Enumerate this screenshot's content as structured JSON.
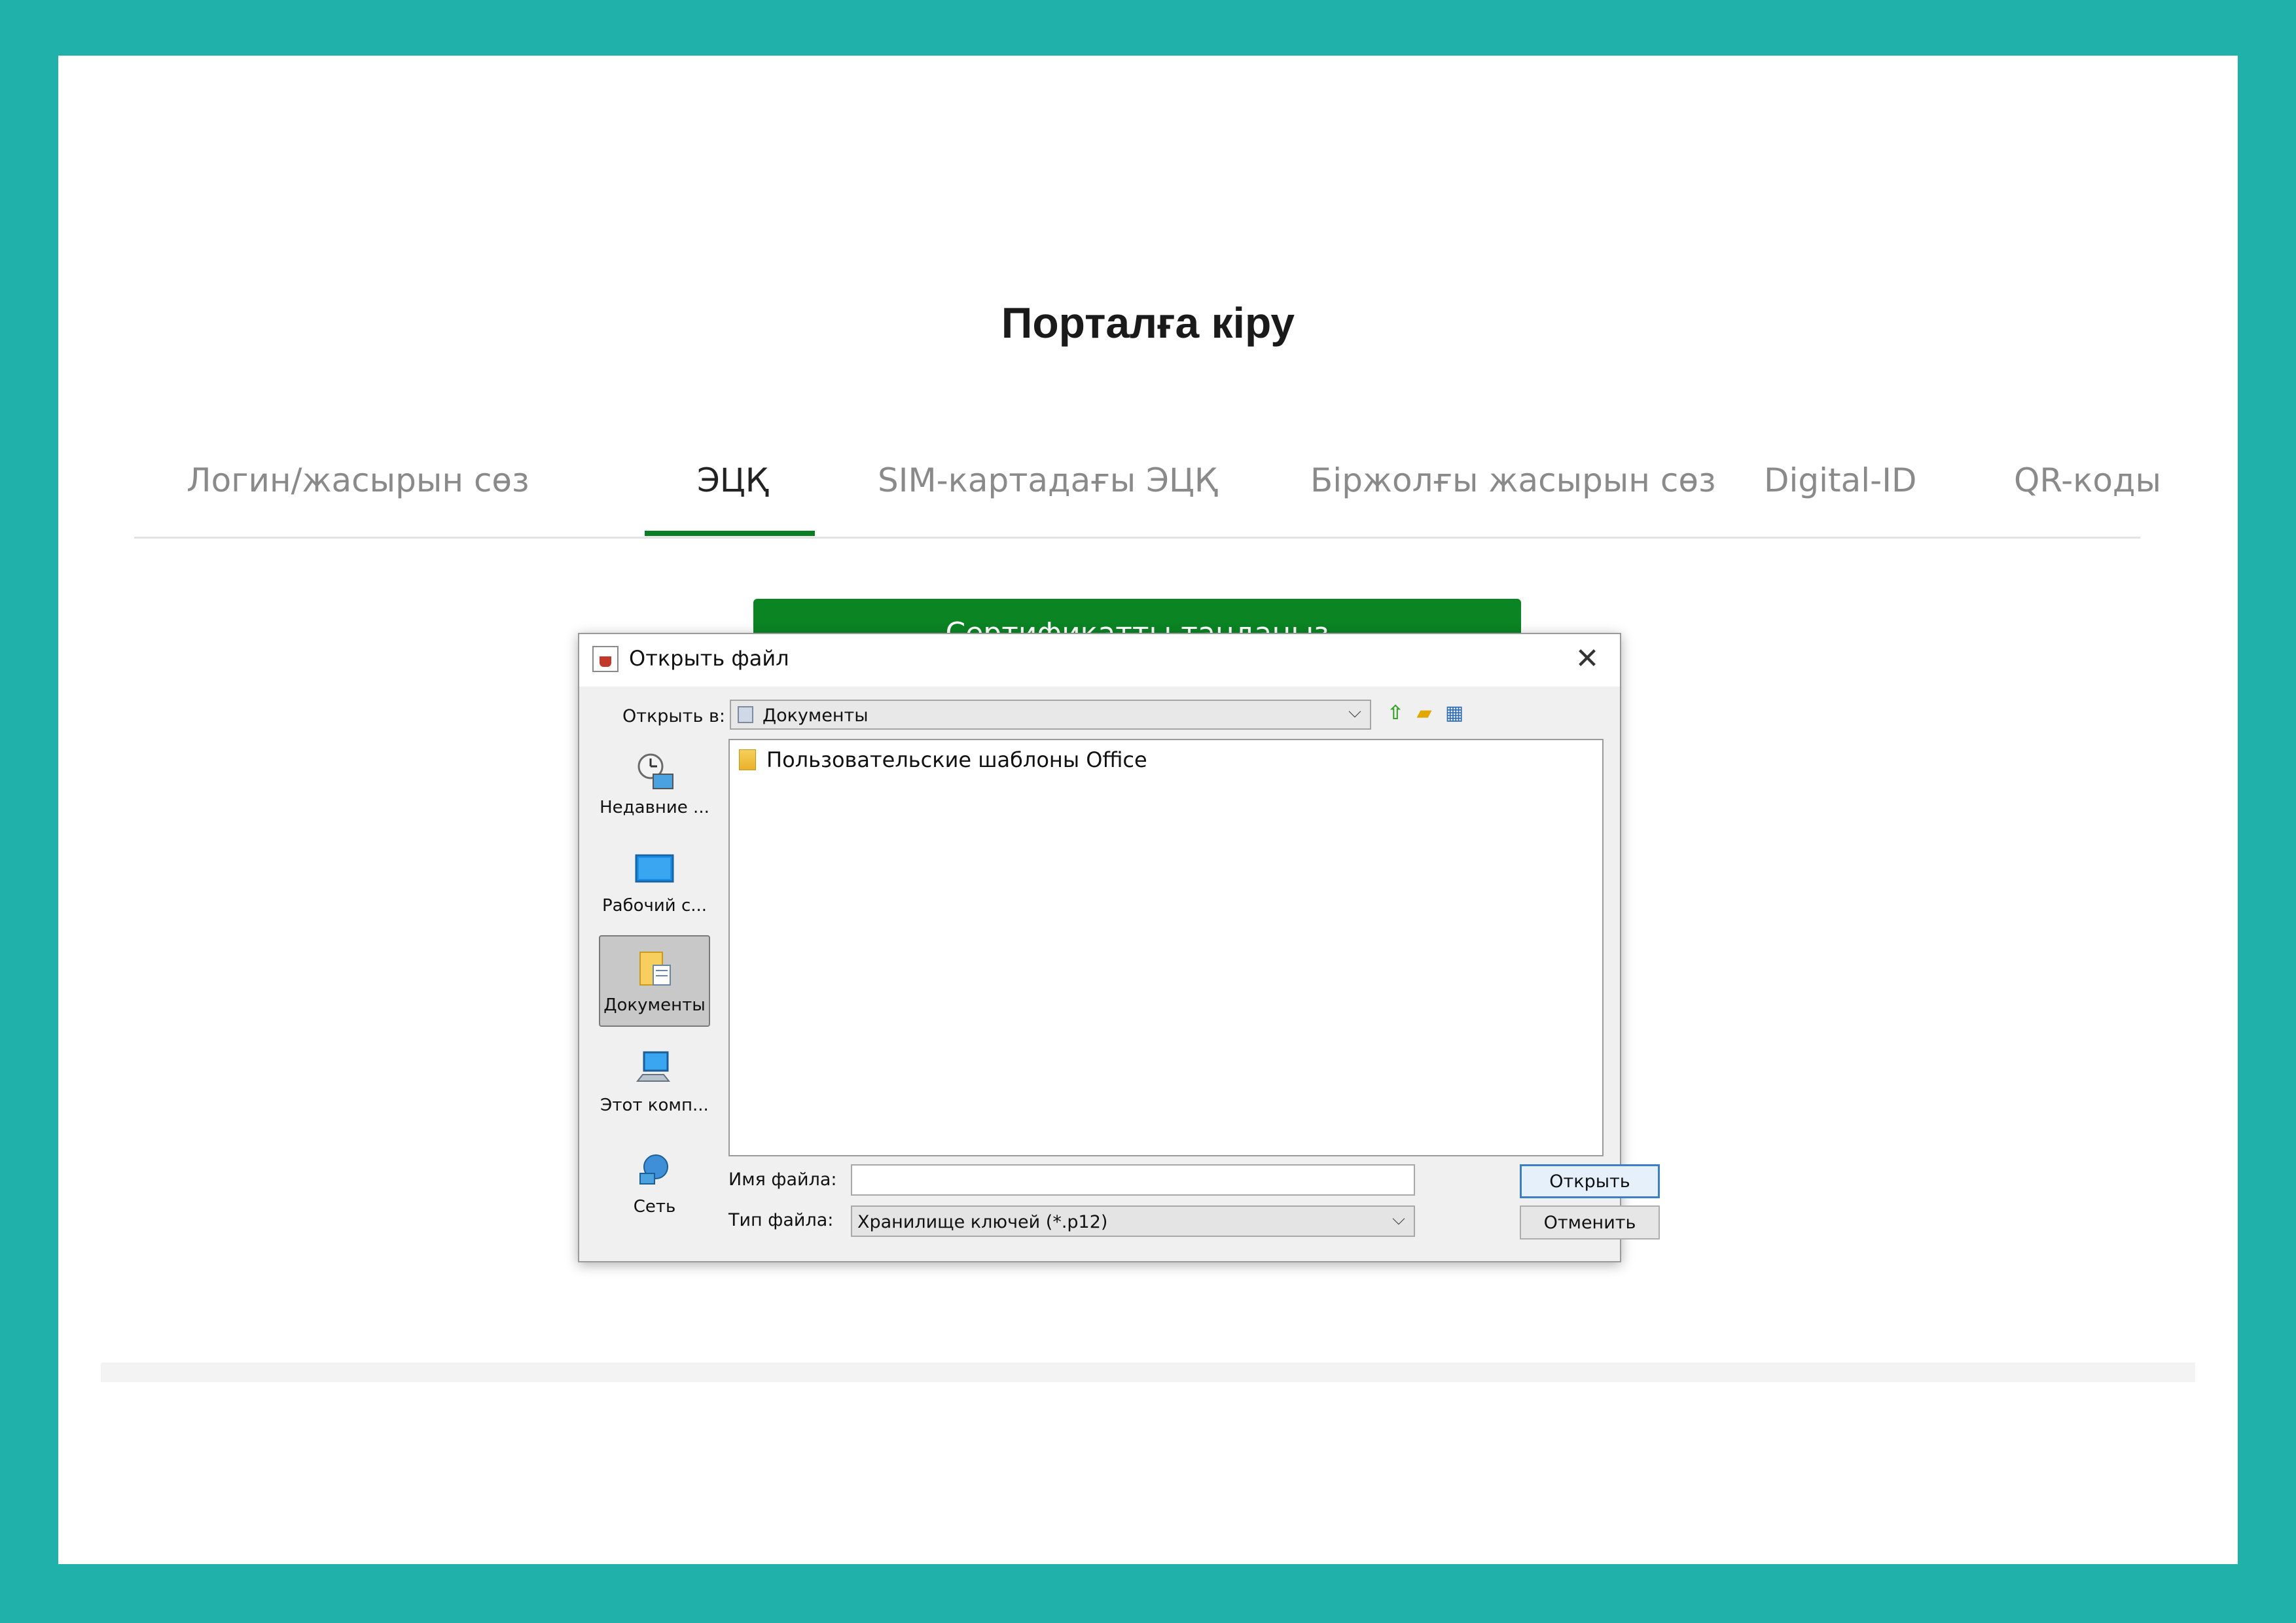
{
  "page": {
    "title": "Порталға кіру",
    "tabs": [
      {
        "label": "Логин/жасырын сөз",
        "active": false
      },
      {
        "label": "ЭЦҚ",
        "active": true
      },
      {
        "label": "SIM-картадағы ЭЦҚ",
        "active": false
      },
      {
        "label": "Біржолғы жасырын сөз",
        "active": false
      },
      {
        "label": "Digital-ID",
        "active": false
      },
      {
        "label": "QR-коды",
        "active": false
      }
    ],
    "select_cert_button": "Сертификатты таңдаңыз",
    "accent_color": "#0b8424",
    "frame_color": "#20b2aa"
  },
  "dialog": {
    "title": "Открыть файл",
    "look_in_label": "Открыть в:",
    "look_in_value": "Документы",
    "places": [
      {
        "label": "Недавние ...",
        "icon": "recent-icon",
        "selected": false
      },
      {
        "label": "Рабочий с...",
        "icon": "desktop-icon",
        "selected": false
      },
      {
        "label": "Документы",
        "icon": "documents-icon",
        "selected": true
      },
      {
        "label": "Этот комп...",
        "icon": "computer-icon",
        "selected": false
      },
      {
        "label": "Сеть",
        "icon": "network-icon",
        "selected": false
      }
    ],
    "files": [
      {
        "name": "Пользовательские шаблоны Office",
        "icon": "folder-icon"
      }
    ],
    "file_name_label": "Имя файла:",
    "file_name_value": "",
    "file_type_label": "Тип файла:",
    "file_type_value": "Хранилище ключей (*.p12)",
    "open_button": "Открыть",
    "cancel_button": "Отменить"
  }
}
